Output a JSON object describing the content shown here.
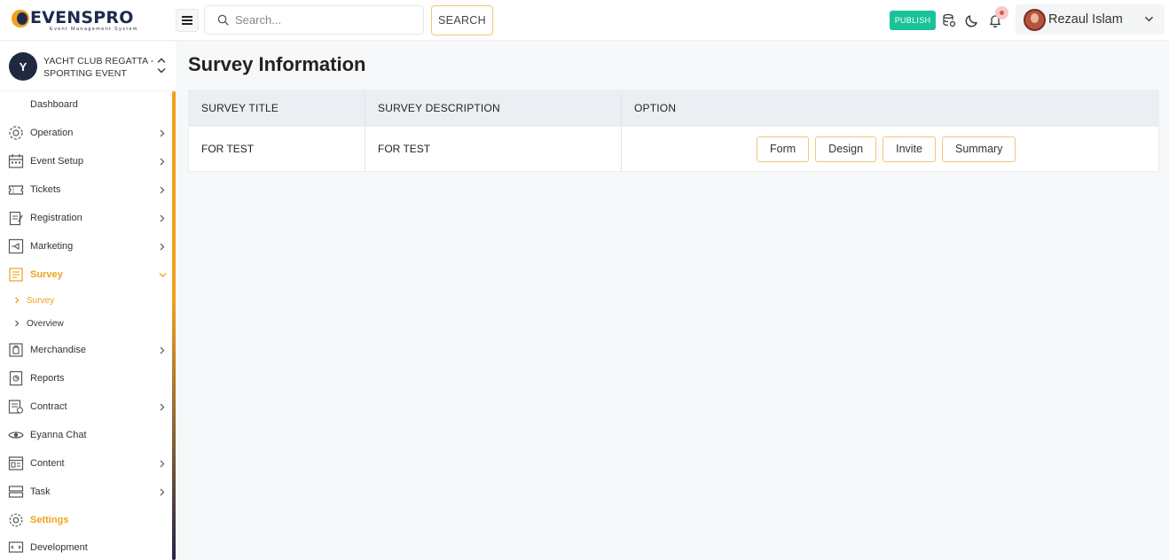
{
  "brand": {
    "name": "EVENSPRO",
    "tagline": "Event Management System"
  },
  "header": {
    "search_placeholder": "Search...",
    "search_button": "SEARCH",
    "publish_button": "PUBLISH",
    "user_name": "Rezaul Islam"
  },
  "event": {
    "initial": "Y",
    "name": "YACHT CLUB REGATTA - SPORTING EVENT"
  },
  "sidebar": {
    "items": [
      {
        "label": "Dashboard"
      },
      {
        "label": "Operation",
        "icon": "gear-icon"
      },
      {
        "label": "Event Setup",
        "icon": "calendar-icon"
      },
      {
        "label": "Tickets",
        "icon": "ticket-icon"
      },
      {
        "label": "Registration",
        "icon": "clipboard-icon"
      },
      {
        "label": "Marketing",
        "icon": "megaphone-icon"
      },
      {
        "label": "Survey",
        "icon": "survey-icon"
      },
      {
        "label": "Merchandise",
        "icon": "bag-icon"
      },
      {
        "label": "Reports",
        "icon": "report-icon"
      },
      {
        "label": "Contract",
        "icon": "contract-icon"
      },
      {
        "label": "Eyanna Chat",
        "icon": "eye-chat-icon"
      },
      {
        "label": "Content",
        "icon": "content-icon"
      },
      {
        "label": "Task",
        "icon": "task-icon"
      },
      {
        "label": "Settings",
        "icon": "settings-icon"
      },
      {
        "label": "Development",
        "icon": "development-icon"
      }
    ],
    "survey_sub": [
      {
        "label": "Survey"
      },
      {
        "label": "Overview"
      }
    ]
  },
  "main": {
    "title": "Survey Information",
    "columns": [
      "SURVEY TITLE",
      "SURVEY DESCRIPTION",
      "OPTION"
    ],
    "rows": [
      {
        "title": "FOR TEST",
        "description": "FOR TEST",
        "options": [
          "Form",
          "Design",
          "Invite",
          "Summary"
        ]
      }
    ]
  },
  "colors": {
    "accent": "#f0a11f",
    "publish": "#18c39a",
    "navy": "#1f2940"
  }
}
